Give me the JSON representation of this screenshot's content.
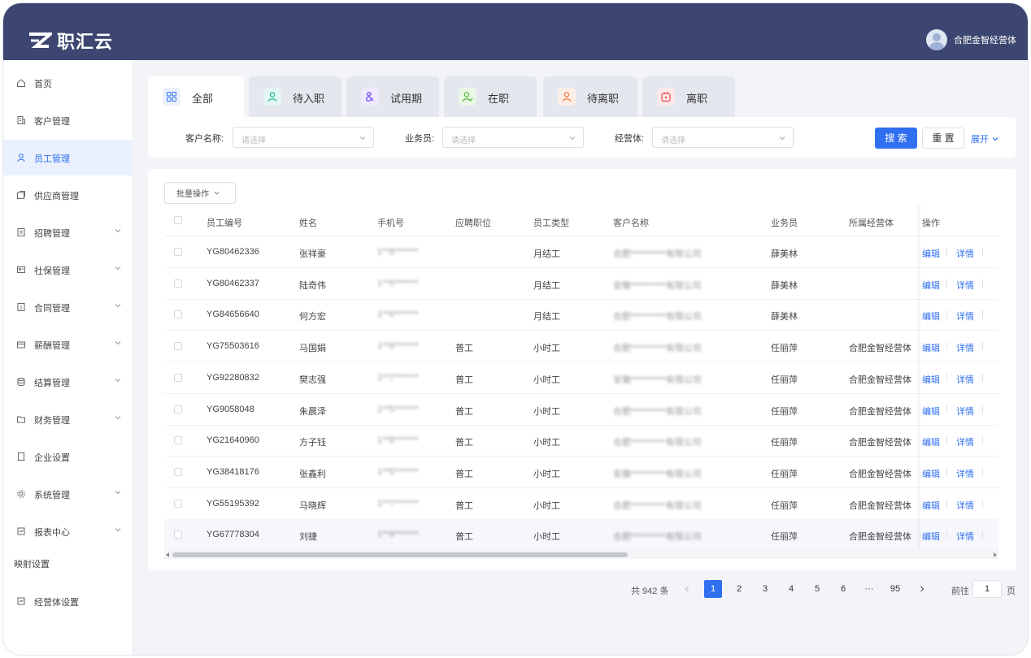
{
  "brand": {
    "name": "职汇云"
  },
  "user": {
    "name": "合肥金智经营体"
  },
  "sidebar": {
    "items": [
      {
        "label": "首页",
        "icon": "home-icon",
        "has_arrow": false,
        "active": false
      },
      {
        "label": "客户管理",
        "icon": "building-icon",
        "has_arrow": false,
        "active": false
      },
      {
        "label": "员工管理",
        "icon": "user-icon",
        "has_arrow": false,
        "active": true
      },
      {
        "label": "供应商管理",
        "icon": "supplier-icon",
        "has_arrow": false,
        "active": false
      },
      {
        "label": "招聘管理",
        "icon": "document-icon",
        "has_arrow": true,
        "active": false
      },
      {
        "label": "社保管理",
        "icon": "id-card-icon",
        "has_arrow": true,
        "active": false
      },
      {
        "label": "合同管理",
        "icon": "contract-icon",
        "has_arrow": true,
        "active": false
      },
      {
        "label": "薪酬管理",
        "icon": "wallet-icon",
        "has_arrow": true,
        "active": false
      },
      {
        "label": "结算管理",
        "icon": "database-icon",
        "has_arrow": true,
        "active": false
      },
      {
        "label": "财务管理",
        "icon": "folder-icon",
        "has_arrow": true,
        "active": false
      },
      {
        "label": "企业设置",
        "icon": "settings-doc-icon",
        "has_arrow": false,
        "active": false
      },
      {
        "label": "系统管理",
        "icon": "gear-icon",
        "has_arrow": true,
        "active": false
      },
      {
        "label": "报表中心",
        "icon": "report-icon",
        "has_arrow": true,
        "active": false
      }
    ],
    "section_label": "映射设置",
    "bottom_item": {
      "label": "经营体设置",
      "icon": "report-icon"
    }
  },
  "tabs": [
    {
      "label": "全部",
      "icon": "grid-icon",
      "bg": "#eaf1fd",
      "fg": "#2f6ff0",
      "active": true
    },
    {
      "label": "待入职",
      "icon": "user-icon",
      "bg": "#e3f6f3",
      "fg": "#1fb59b",
      "active": false
    },
    {
      "label": "试用期",
      "icon": "ampersand-icon",
      "bg": "#efeafd",
      "fg": "#7b5cf0",
      "active": false
    },
    {
      "label": "在职",
      "icon": "user-check-icon",
      "bg": "#eaf7e6",
      "fg": "#57b93a",
      "active": false
    },
    {
      "label": "待离职",
      "icon": "user-icon",
      "bg": "#fdeee6",
      "fg": "#f07a3c",
      "active": false
    },
    {
      "label": "离职",
      "icon": "box-icon",
      "bg": "#fde9e9",
      "fg": "#ee4d4d",
      "active": false
    }
  ],
  "filter": {
    "customer_label": "客户名称:",
    "customer_placeholder": "请选择",
    "salesperson_label": "业务员:",
    "salesperson_placeholder": "请选择",
    "entity_label": "经营体:",
    "entity_placeholder": "请选择",
    "search_label": "搜 索",
    "reset_label": "重 置",
    "expand_label": "展开"
  },
  "table": {
    "batch_label": "批量操作",
    "headers": {
      "emp_no": "员工编号",
      "name": "姓名",
      "phone": "手机号",
      "position": "应聘职位",
      "emp_type": "员工类型",
      "customer": "客户名称",
      "sales": "业务员",
      "entity": "所属经营体",
      "ops": "操作"
    },
    "rows": [
      {
        "emp_no": "YG80462336",
        "name": "张祥豪",
        "phone": "1**8*******",
        "position": "",
        "emp_type": "月结工",
        "customer": "合肥**********有限公司",
        "sales": "薛美林",
        "entity": "",
        "edit": "编辑",
        "detail": "详情"
      },
      {
        "emp_no": "YG80462337",
        "name": "陆奇伟",
        "phone": "1**5*******",
        "position": "",
        "emp_type": "月结工",
        "customer": "安徽**********有限公司",
        "sales": "薛美林",
        "entity": "",
        "edit": "编辑",
        "detail": "详情"
      },
      {
        "emp_no": "YG84656640",
        "name": "何方宏",
        "phone": "1**6*******",
        "position": "",
        "emp_type": "月结工",
        "customer": "合肥**********有限公司",
        "sales": "薛美林",
        "entity": "",
        "edit": "编辑",
        "detail": "详情"
      },
      {
        "emp_no": "YG75503616",
        "name": "马国娟",
        "phone": "1**8*******",
        "position": "普工",
        "emp_type": "小时工",
        "customer": "合肥**********有限公司",
        "sales": "任丽萍",
        "entity": "合肥金智经营体",
        "edit": "编辑",
        "detail": "详情"
      },
      {
        "emp_no": "YG92280832",
        "name": "樊志强",
        "phone": "1**7*******",
        "position": "普工",
        "emp_type": "小时工",
        "customer": "安徽**********有限公司",
        "sales": "任丽萍",
        "entity": "合肥金智经营体",
        "edit": "编辑",
        "detail": "详情"
      },
      {
        "emp_no": "YG9058048",
        "name": "朱晨泽",
        "phone": "1**5*******",
        "position": "普工",
        "emp_type": "小时工",
        "customer": "合肥**********有限公司",
        "sales": "任丽萍",
        "entity": "合肥金智经营体",
        "edit": "编辑",
        "detail": "详情"
      },
      {
        "emp_no": "YG21640960",
        "name": "方子钰",
        "phone": "1**8*******",
        "position": "普工",
        "emp_type": "小时工",
        "customer": "合肥**********有限公司",
        "sales": "任丽萍",
        "entity": "合肥金智经营体",
        "edit": "编辑",
        "detail": "详情"
      },
      {
        "emp_no": "YG38418176",
        "name": "张鑫利",
        "phone": "1**5*******",
        "position": "普工",
        "emp_type": "小时工",
        "customer": "安徽**********有限公司",
        "sales": "任丽萍",
        "entity": "合肥金智经营体",
        "edit": "编辑",
        "detail": "详情"
      },
      {
        "emp_no": "YG55195392",
        "name": "马晓辉",
        "phone": "1**7*******",
        "position": "普工",
        "emp_type": "小时工",
        "customer": "合肥**********有限公司",
        "sales": "任丽萍",
        "entity": "合肥金智经营体",
        "edit": "编辑",
        "detail": "详情"
      },
      {
        "emp_no": "YG67778304",
        "name": "刘捷",
        "phone": "1**8*******",
        "position": "普工",
        "emp_type": "小时工",
        "customer": "合肥**********有限公司",
        "sales": "任丽萍",
        "entity": "合肥金智经营体",
        "edit": "编辑",
        "detail": "详情"
      }
    ]
  },
  "pagination": {
    "total_label": "共 942 条",
    "pages": [
      "1",
      "2",
      "3",
      "4",
      "5",
      "6",
      "···",
      "95"
    ],
    "current": "1",
    "goto_label": "前往",
    "goto_value": "1",
    "page_unit": "页"
  },
  "colors": {
    "topbar": "#3c4670",
    "accent": "#2f6ff0",
    "active_nav_bg": "#eaf1fd"
  }
}
